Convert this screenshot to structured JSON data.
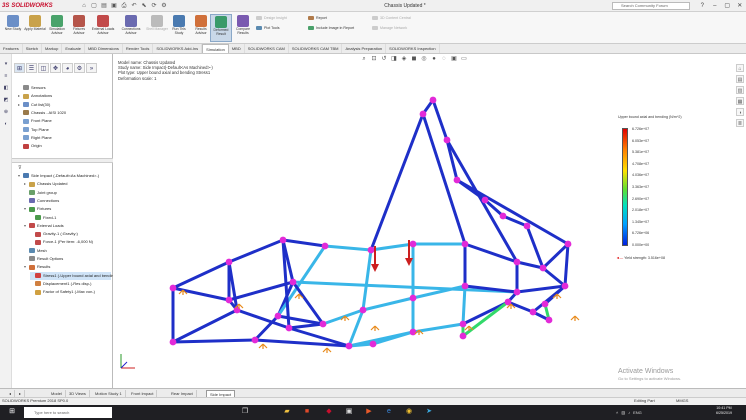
{
  "app": {
    "logo_text": "SOLIDWORKS",
    "document_title": "Chassis Updated *",
    "search_placeholder": "Search Community Forum"
  },
  "ribbon": {
    "buttons": [
      {
        "id": "new-study",
        "label": "New Study",
        "color": "#6b8fc7"
      },
      {
        "id": "apply-material",
        "label": "Apply Material",
        "color": "#c9a24a"
      },
      {
        "id": "simulation-advisor",
        "label": "Simulation Advisor",
        "color": "#4aa36b"
      },
      {
        "id": "fixtures-advisor",
        "label": "Fixtures Advisor",
        "color": "#b5554a"
      },
      {
        "id": "external-loads-advisor",
        "label": "External Loads Advisor",
        "color": "#c24a4a"
      },
      {
        "id": "connections-advisor",
        "label": "Connections Advisor",
        "color": "#6a6ab0"
      },
      {
        "id": "shell-manager",
        "label": "Shell Manager",
        "color": "#bbbbbb",
        "disabled": true
      },
      {
        "id": "run-this-study",
        "label": "Run This Study",
        "color": "#4a7ab0"
      },
      {
        "id": "results-advisor",
        "label": "Results Advisor",
        "color": "#d0703a"
      },
      {
        "id": "deformed-result",
        "label": "Deformed Result",
        "color": "#3a9a6a",
        "active": true
      },
      {
        "id": "compare-results",
        "label": "Compare Results",
        "color": "#7a5ab0"
      }
    ],
    "small_items": [
      {
        "id": "design-insight",
        "label": "Design Insight",
        "disabled": true
      },
      {
        "id": "plot-tools",
        "label": "Plot Tools"
      },
      {
        "id": "report",
        "label": "Report"
      },
      {
        "id": "include-image",
        "label": "Include Image in Report"
      },
      {
        "id": "3d-content",
        "label": "3D Content Central",
        "disabled": true
      },
      {
        "id": "manage-network",
        "label": "Manage Network",
        "disabled": true
      }
    ]
  },
  "tabs": [
    {
      "label": "Features"
    },
    {
      "label": "Sketch"
    },
    {
      "label": "Markup"
    },
    {
      "label": "Evaluate"
    },
    {
      "label": "MBD Dimensions"
    },
    {
      "label": "Render Tools"
    },
    {
      "label": "SOLIDWORKS Add-Ins"
    },
    {
      "label": "Simulation",
      "active": true
    },
    {
      "label": "MBD"
    },
    {
      "label": "SOLIDWORKS CAM"
    },
    {
      "label": "SOLIDWORKS CAM TBM"
    },
    {
      "label": "Analysis Preparation"
    },
    {
      "label": "SOLIDWORKS Inspection"
    }
  ],
  "tree_top": [
    {
      "label": "Sensors",
      "indent": 0,
      "toggle": "",
      "color": "#8a8a8a"
    },
    {
      "label": "Annotations",
      "indent": 0,
      "toggle": "▸",
      "color": "#c9a24a"
    },
    {
      "label": "Cut list(30)",
      "indent": 0,
      "toggle": "▸",
      "color": "#6b8fc7"
    },
    {
      "label": "Chassis - AISI 1020",
      "indent": 0,
      "toggle": "",
      "color": "#9a7a4a"
    },
    {
      "label": "Front Plane",
      "indent": 0,
      "toggle": "",
      "color": "#7aa0d0"
    },
    {
      "label": "Top Plane",
      "indent": 0,
      "toggle": "",
      "color": "#7aa0d0"
    },
    {
      "label": "Right Plane",
      "indent": 0,
      "toggle": "",
      "color": "#7aa0d0"
    },
    {
      "label": "Origin",
      "indent": 0,
      "toggle": "",
      "color": "#c04040"
    }
  ],
  "tree_bottom": [
    {
      "label": "Side Impact (-Default<As Machined>-)",
      "indent": 0,
      "toggle": "▾",
      "color": "#4a7ab0"
    },
    {
      "label": "Chassis Updated",
      "indent": 1,
      "toggle": "▸",
      "color": "#c9a24a"
    },
    {
      "label": "Joint group",
      "indent": 1,
      "toggle": "",
      "color": "#6aa06a"
    },
    {
      "label": "Connections",
      "indent": 1,
      "toggle": "",
      "color": "#6a6ab0"
    },
    {
      "label": "Fixtures",
      "indent": 1,
      "toggle": "▾",
      "color": "#4a9a4a"
    },
    {
      "label": "Fixed-1",
      "indent": 2,
      "toggle": "",
      "color": "#4a9a4a"
    },
    {
      "label": "External Loads",
      "indent": 1,
      "toggle": "▾",
      "color": "#c24a4a"
    },
    {
      "label": "Gravity-1 (:Gravity:)",
      "indent": 2,
      "toggle": "",
      "color": "#c24a4a"
    },
    {
      "label": "Force-1 (Per item: -6,000 N)",
      "indent": 2,
      "toggle": "",
      "color": "#c24a4a"
    },
    {
      "label": "Mesh",
      "indent": 1,
      "toggle": "",
      "color": "#5a8ab0"
    },
    {
      "label": "Result Options",
      "indent": 1,
      "toggle": "",
      "color": "#8a8a8a"
    },
    {
      "label": "Results",
      "indent": 1,
      "toggle": "▾",
      "color": "#d0703a"
    },
    {
      "label": "Stress1 (-Upper bound axial and bending-)",
      "indent": 2,
      "toggle": "",
      "color": "#d04040",
      "selected": true
    },
    {
      "label": "Displacement1 (-Res disp-)",
      "indent": 2,
      "toggle": "",
      "color": "#d08040"
    },
    {
      "label": "Factor of Safety1 (-Max von-)",
      "indent": 2,
      "toggle": "",
      "color": "#d0a040"
    }
  ],
  "viewport": {
    "header_lines": [
      "Model name: Chassis Updated",
      "Study name: Side Impact(-Default<As Machined>-)",
      "Plot type: Upper bound axial and bending Stress1",
      "Deformation scale: 1"
    ],
    "legend_title": "Upper bound axial and bending (N/m^2)",
    "legend_values": [
      "6.726e+07",
      "6.053e+07",
      "5.381e+07",
      "4.708e+07",
      "4.036e+07",
      "3.363e+07",
      "2.690e+07",
      "2.018e+07",
      "1.345e+07",
      "6.726e+06",
      "0.000e+00"
    ],
    "yield_label": "Yield strength: 3.516e+08",
    "activate_heading": "Activate Windows",
    "activate_sub": "Go to Settings to activate Windows."
  },
  "model_colors": {
    "frame_low": "#1e2fc8",
    "frame_mid": "#39b6e8",
    "frame_high": "#32d96a",
    "joint": "#e22ad8",
    "load_arrow": "#cc1f1f",
    "fixture": "#e88a1a"
  },
  "bottom_tabs": [
    {
      "label": "Model"
    },
    {
      "label": "3D Views"
    },
    {
      "label": "Motion Study 1"
    },
    {
      "label": "Front Impact"
    },
    {
      "label": "Rear Impact"
    },
    {
      "label": "Side Impact",
      "active": true
    }
  ],
  "status": {
    "left": "SOLIDWORKS Premium 2018 SP0.0",
    "editing": "Editing Part",
    "units": "MMGS",
    "lang": "ENG"
  },
  "taskbar": {
    "search_placeholder": "Type here to search",
    "time": "10:41 PM",
    "date": "6/25/2019"
  }
}
